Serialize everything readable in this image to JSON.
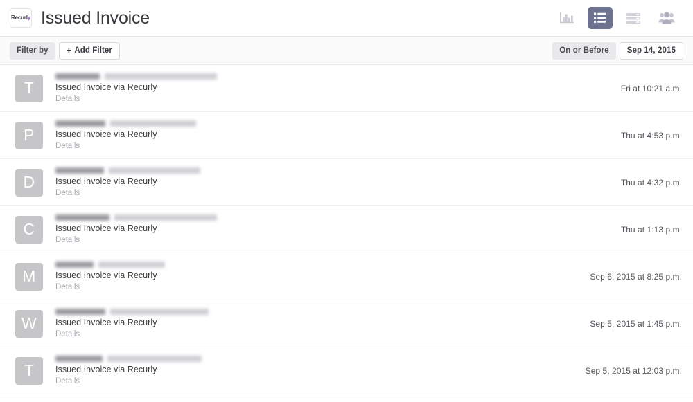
{
  "header": {
    "logo_main": "Recurl",
    "logo_tail": "y",
    "logo_name": "recurly-logo",
    "title": "Issued Invoice",
    "icons": [
      {
        "name": "bar-chart-icon",
        "label": "Analytics"
      },
      {
        "name": "list-view-icon",
        "label": "List",
        "active": true
      },
      {
        "name": "rows-view-icon",
        "label": "Rows"
      },
      {
        "name": "people-icon",
        "label": "People"
      }
    ]
  },
  "filterbar": {
    "filter_by_label": "Filter by",
    "add_filter_label": "Add Filter",
    "add_filter_plus": "+",
    "date_condition_label": "On or Before",
    "date_value": "Sep 14, 2015"
  },
  "list": {
    "rows": [
      {
        "avatar": "T",
        "name_width": 64,
        "email_width": 162,
        "action": "Issued Invoice via Recurly",
        "details": "Details",
        "time": "Fri at 10:21 a.m."
      },
      {
        "avatar": "P",
        "name_width": 72,
        "email_width": 124,
        "action": "Issued Invoice via Recurly",
        "details": "Details",
        "time": "Thu at 4:53 p.m."
      },
      {
        "avatar": "D",
        "name_width": 70,
        "email_width": 132,
        "action": "Issued Invoice via Recurly",
        "details": "Details",
        "time": "Thu at 4:32 p.m."
      },
      {
        "avatar": "C",
        "name_width": 78,
        "email_width": 148,
        "action": "Issued Invoice via Recurly",
        "details": "Details",
        "time": "Thu at 1:13 p.m."
      },
      {
        "avatar": "M",
        "name_width": 55,
        "email_width": 96,
        "action": "Issued Invoice via Recurly",
        "details": "Details",
        "time": "Sep 6, 2015 at 8:25 p.m."
      },
      {
        "avatar": "W",
        "name_width": 72,
        "email_width": 142,
        "action": "Issued Invoice via Recurly",
        "details": "Details",
        "time": "Sep 5, 2015 at 1:45 p.m."
      },
      {
        "avatar": "T",
        "name_width": 68,
        "email_width": 136,
        "action": "Issued Invoice via Recurly",
        "details": "Details",
        "time": "Sep 5, 2015 at 12:03 p.m."
      }
    ]
  },
  "colors": {
    "active_icon_bg": "#6d738f",
    "avatar_bg": "#c6c6c8",
    "brand_accent": "#8a4fc0",
    "filterbar_bg": "#fbfbfc",
    "divider": "#eeeef0"
  }
}
